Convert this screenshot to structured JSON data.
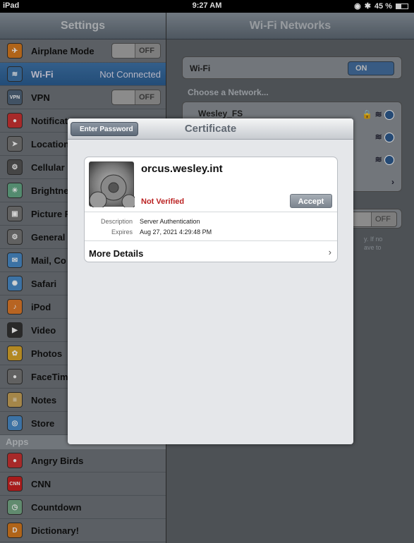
{
  "status": {
    "device": "iPad",
    "time": "9:27 AM",
    "battery": "45 %"
  },
  "left": {
    "title": "Settings",
    "items": [
      {
        "label": "Airplane Mode",
        "value": "OFF",
        "icon": "airplane-icon",
        "color": "#d77a1f"
      },
      {
        "label": "Wi-Fi",
        "value": "Not Connected",
        "icon": "wifi-icon",
        "color": "#3f74a9"
      },
      {
        "label": "VPN",
        "value": "OFF",
        "icon": "vpn-icon",
        "color": "#50657a"
      },
      {
        "label": "Notificat",
        "value": "",
        "icon": "notifications-icon",
        "color": "#c33"
      },
      {
        "label": "Location",
        "value": "",
        "icon": "location-icon",
        "color": "#777"
      },
      {
        "label": "Cellular",
        "value": "",
        "icon": "cellular-icon",
        "color": "#555"
      },
      {
        "label": "Brightne",
        "value": "",
        "icon": "brightness-icon",
        "color": "#6a8"
      },
      {
        "label": "Picture F",
        "value": "",
        "icon": "picture-frame-icon",
        "color": "#777"
      },
      {
        "label": "General",
        "value": "",
        "icon": "gear-icon",
        "color": "#777"
      },
      {
        "label": "Mail, Co",
        "value": "",
        "icon": "mail-icon",
        "color": "#4a8cc9"
      },
      {
        "label": "Safari",
        "value": "",
        "icon": "safari-icon",
        "color": "#4a8cc9"
      },
      {
        "label": "iPod",
        "value": "",
        "icon": "ipod-icon",
        "color": "#e07a2a"
      },
      {
        "label": "Video",
        "value": "",
        "icon": "video-icon",
        "color": "#333"
      },
      {
        "label": "Photos",
        "value": "",
        "icon": "photos-icon",
        "color": "#d9a72a"
      },
      {
        "label": "FaceTim",
        "value": "",
        "icon": "facetime-icon",
        "color": "#777"
      },
      {
        "label": "Notes",
        "value": "",
        "icon": "notes-icon",
        "color": "#c9a45a"
      },
      {
        "label": "Store",
        "value": "",
        "icon": "store-icon",
        "color": "#4a8cc9"
      }
    ],
    "apps_header": "Apps",
    "apps": [
      {
        "label": "Angry Birds",
        "icon": "angry-birds-icon",
        "color": "#c33"
      },
      {
        "label": "CNN",
        "icon": "cnn-icon",
        "color": "#c22"
      },
      {
        "label": "Countdown",
        "icon": "countdown-icon",
        "color": "#7a8"
      },
      {
        "label": "Dictionary!",
        "icon": "dictionary-icon",
        "color": "#d77a1f"
      }
    ]
  },
  "right": {
    "title": "Wi-Fi Networks",
    "wifi_label": "Wi-Fi",
    "wifi_value": "ON",
    "choose": "Choose a Network...",
    "network": "Wesley_FS",
    "off_value": "OFF",
    "hint1": "y. If no",
    "hint2": "ave to"
  },
  "dialog": {
    "back": "Enter Password",
    "title": "Certificate",
    "name": "orcus.wesley.int",
    "status": "Not Verified",
    "accept": "Accept",
    "desc_label": "Description",
    "desc_value": "Server Authentication",
    "exp_label": "Expires",
    "exp_value": "Aug 27, 2021 4:29:48 PM",
    "more": "More Details"
  }
}
